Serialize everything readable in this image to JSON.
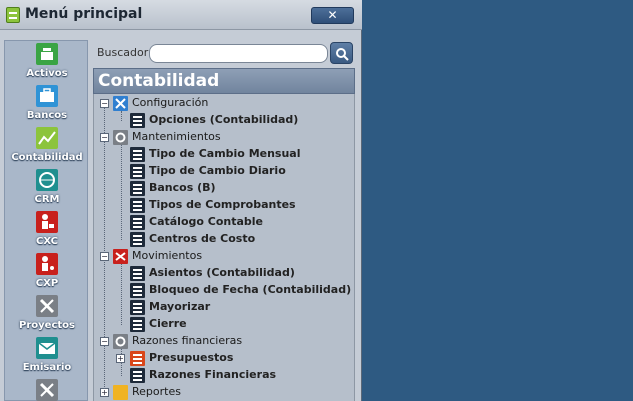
{
  "window": {
    "title": "Menú principal",
    "close_label": "✕"
  },
  "nav": {
    "items": [
      {
        "label": "Activos",
        "icon": "cash-register-icon",
        "color": "#3aa444"
      },
      {
        "label": "Bancos",
        "icon": "briefcase-icon",
        "color": "#2f93d6"
      },
      {
        "label": "Contabilidad",
        "icon": "chart-icon",
        "color": "#8cc43c"
      },
      {
        "label": "CRM",
        "icon": "globe-icon",
        "color": "#1f8f8f"
      },
      {
        "label": "CXC",
        "icon": "person-money-icon",
        "color": "#c8201c"
      },
      {
        "label": "CXP",
        "icon": "person-coins-icon",
        "color": "#c8201c"
      },
      {
        "label": "Proyectos",
        "icon": "tools-icon",
        "color": "#7a7f86"
      },
      {
        "label": "Emisario",
        "icon": "envelope-icon",
        "color": "#1f8f8f"
      },
      {
        "label": "",
        "icon": "wrench-icon",
        "color": "#7a7f86"
      }
    ]
  },
  "search": {
    "label": "Buscador:",
    "placeholder": "",
    "value": ""
  },
  "section": {
    "title": "Contabilidad"
  },
  "tree": {
    "configuracion": {
      "label": "Configuración"
    },
    "opciones": {
      "label": "Opciones (Contabilidad)"
    },
    "mantenimientos": {
      "label": "Mantenimientos"
    },
    "tipo_cambio_mensual": {
      "label": "Tipo de Cambio Mensual"
    },
    "tipo_cambio_diario": {
      "label": "Tipo de Cambio Diario"
    },
    "bancos_b": {
      "label": "Bancos (B)"
    },
    "tipos_comprobantes": {
      "label": "Tipos de Comprobantes"
    },
    "catalogo_contable": {
      "label": "Catálogo Contable"
    },
    "centros_costo": {
      "label": "Centros de Costo"
    },
    "movimientos": {
      "label": "Movimientos"
    },
    "asientos": {
      "label": "Asientos (Contabilidad)"
    },
    "bloqueo_fecha": {
      "label": "Bloqueo de Fecha (Contabilidad)"
    },
    "mayorizar": {
      "label": "Mayorizar"
    },
    "cierre": {
      "label": "Cierre"
    },
    "razones_financieras": {
      "label": "Razones financieras"
    },
    "presupuestos": {
      "label": "Presupuestos"
    },
    "razones_financieras_leaf": {
      "label": "Razones Financieras"
    },
    "reportes": {
      "label": "Reportes"
    }
  }
}
